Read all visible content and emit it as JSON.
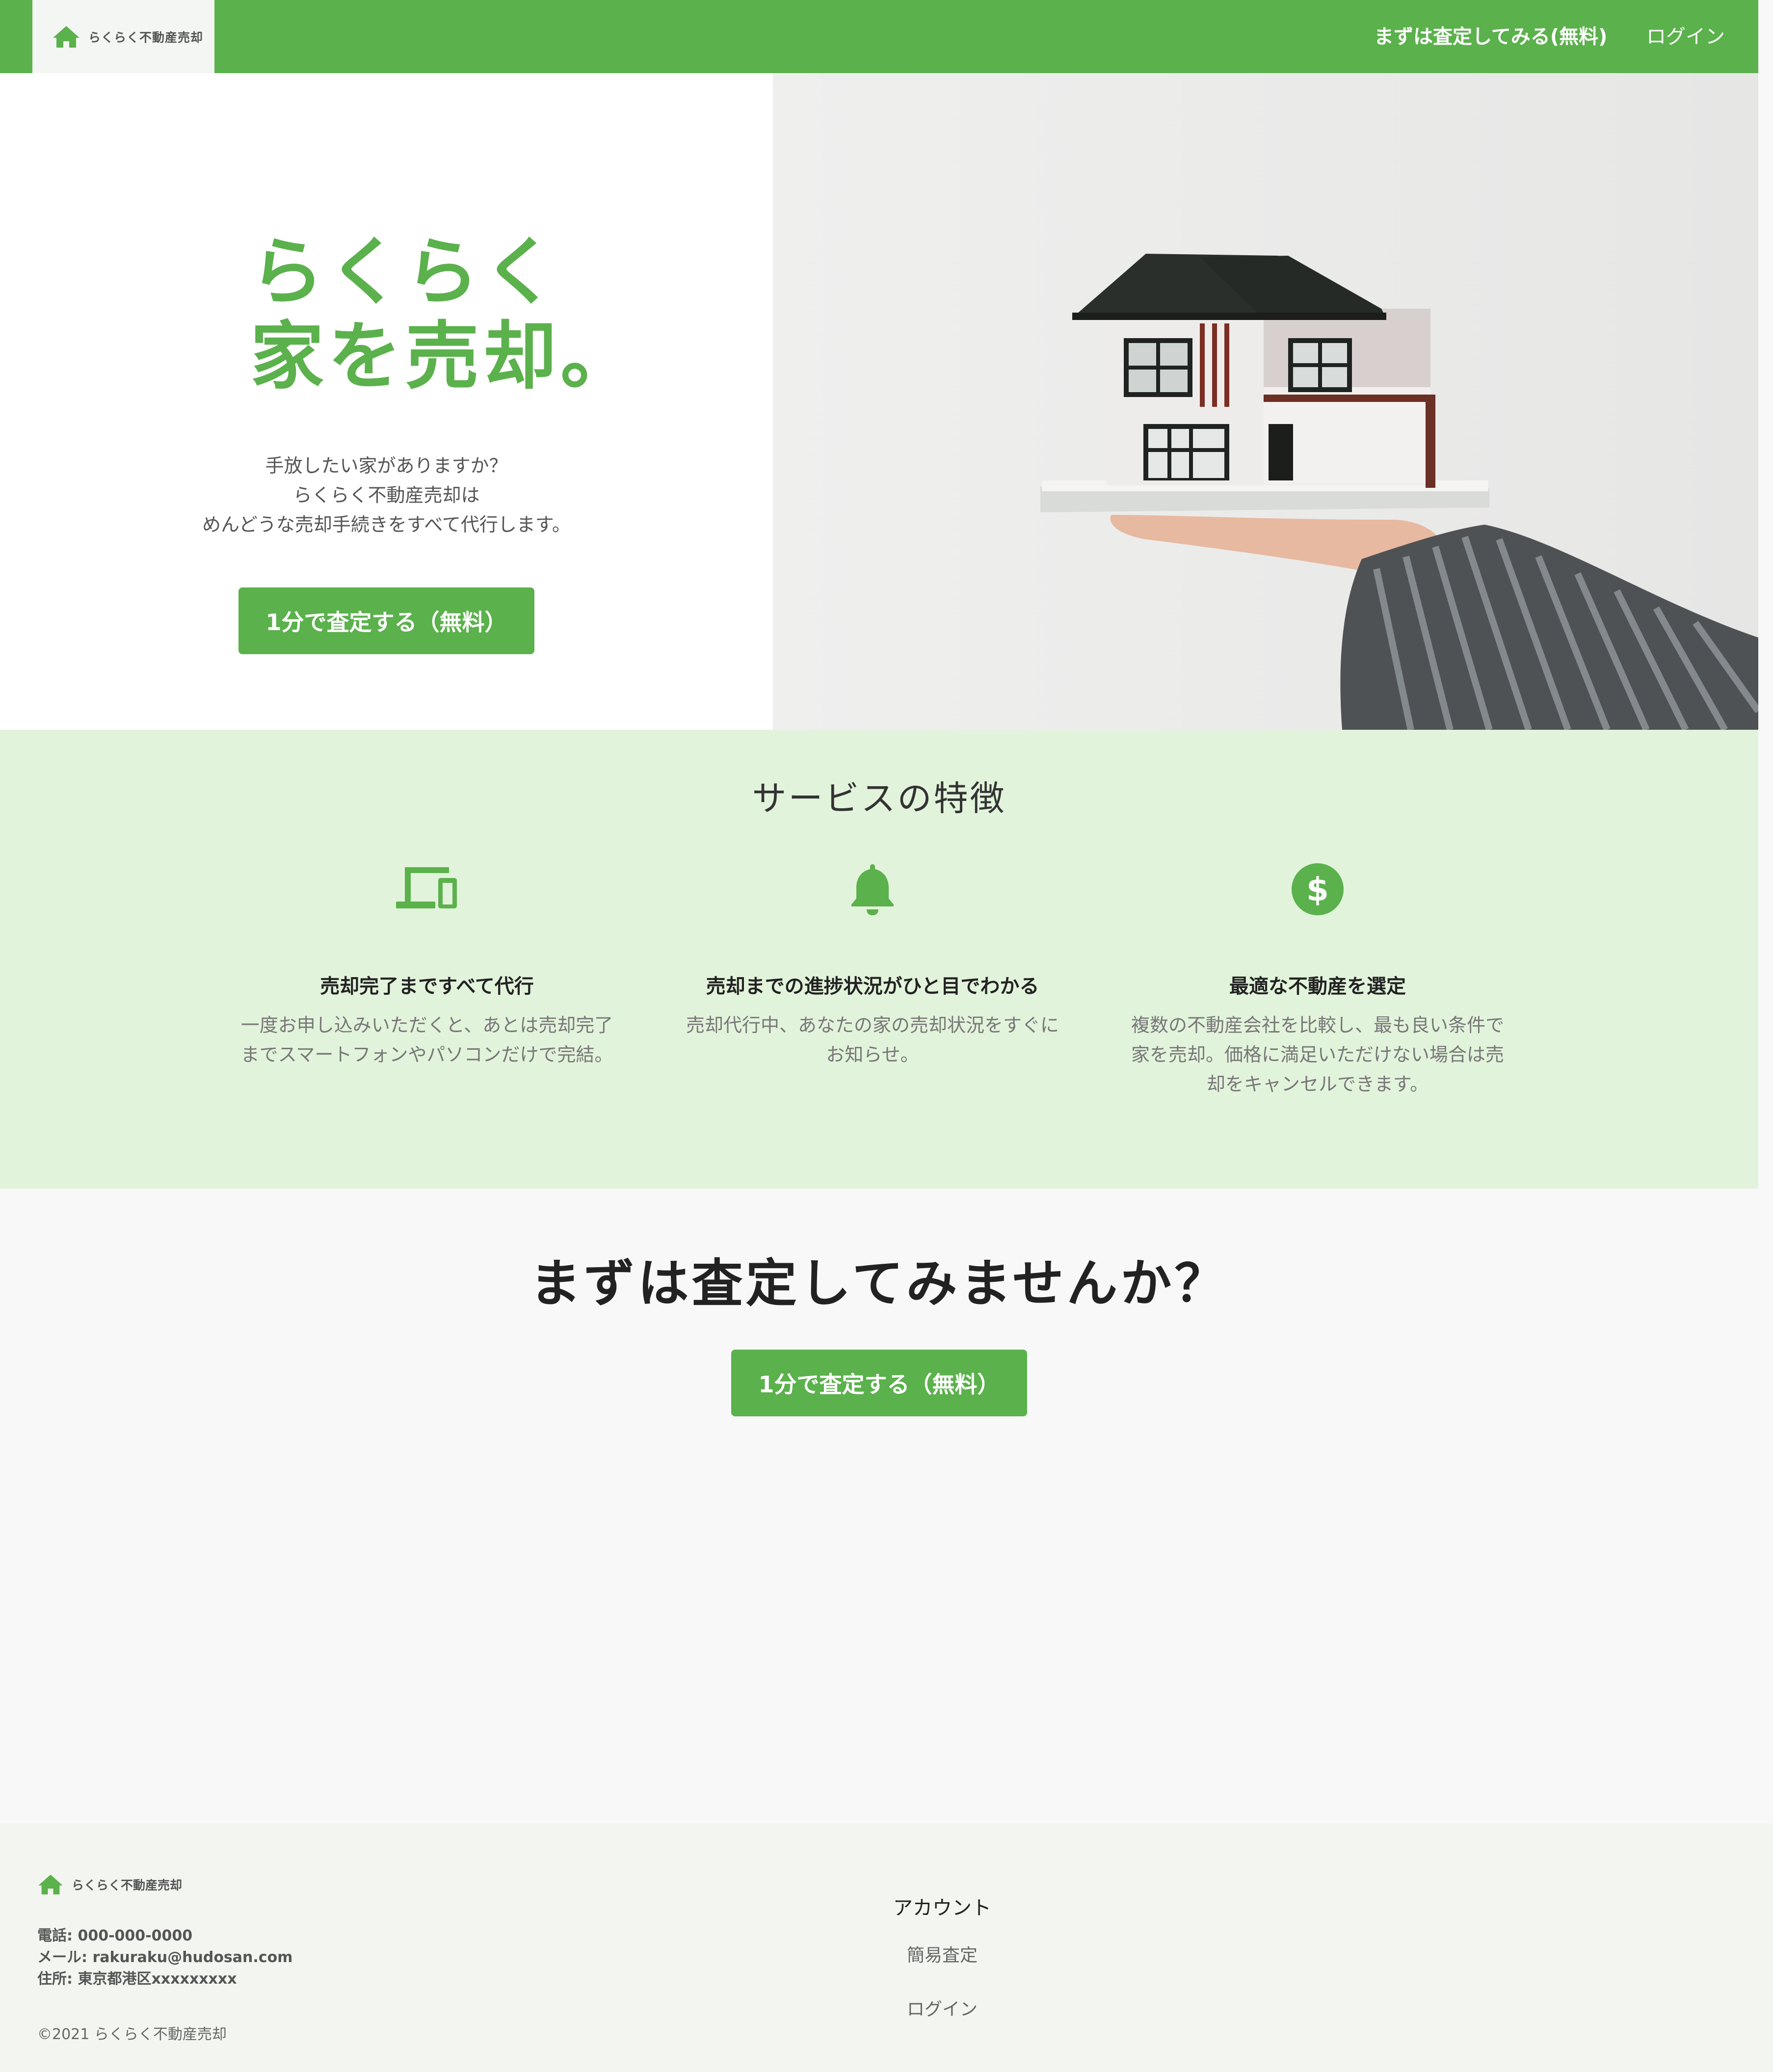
{
  "brand": {
    "name": "らくらく不動産売却",
    "color": "#5bb14c"
  },
  "header": {
    "cta_label": "まずは査定してみる(無料)",
    "login_label": "ログイン"
  },
  "hero": {
    "title_line1": "らくらく",
    "title_line2": "家を売却。",
    "desc_line1": "手放したい家がありますか？",
    "desc_line2": "らくらく不動産売却は",
    "desc_line3": "めんどうな売却手続きをすべて代行します。",
    "button_label": "1分で査定する（無料）"
  },
  "features": {
    "title": "サービスの特徴",
    "items": [
      {
        "icon": "devices-icon",
        "title": "売却完了まですべて代行",
        "desc": "一度お申し込みいただくと、あとは売却完了までスマートフォンやパソコンだけで完結。"
      },
      {
        "icon": "bell-icon",
        "title": "売却までの進捗状況がひと目でわかる",
        "desc": "売却代行中、あなたの家の売却状況をすぐにお知らせ。"
      },
      {
        "icon": "dollar-circle-icon",
        "title": "最適な不動産を選定",
        "desc": "複数の不動産会社を比較し、最も良い条件で家を売却。価格に満足いただけない場合は売却をキャンセルできます。"
      }
    ]
  },
  "cta": {
    "title": "まずは査定してみませんか？",
    "button_label": "1分で査定する（無料）"
  },
  "footer": {
    "phone": "電話: 000-000-0000",
    "email": "メール: rakuraku@hudosan.com",
    "address": "住所: 東京都港区xxxxxxxxx",
    "copyright": "©2021 らくらく不動産売却",
    "account": {
      "title": "アカウント",
      "links": [
        "簡易査定",
        "ログイン"
      ]
    }
  }
}
